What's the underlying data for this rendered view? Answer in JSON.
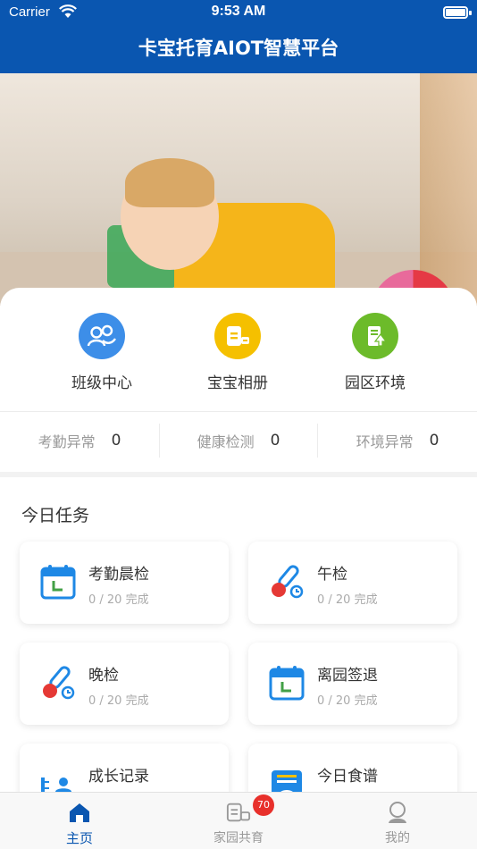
{
  "status_bar": {
    "carrier": "Carrier",
    "time": "9:53 AM"
  },
  "nav": {
    "title": "卡宝托育AIOT智慧平台"
  },
  "shortcuts": [
    {
      "label": "班级中心",
      "icon": "class-center-icon"
    },
    {
      "label": "宝宝相册",
      "icon": "baby-album-icon"
    },
    {
      "label": "园区环境",
      "icon": "campus-environment-icon"
    }
  ],
  "stats": [
    {
      "name": "考勤异常",
      "value": "0"
    },
    {
      "name": "健康检测",
      "value": "0"
    },
    {
      "name": "环境异常",
      "value": "0"
    }
  ],
  "tasks": {
    "heading": "今日任务",
    "items": [
      {
        "name": "考勤晨检",
        "progress": "0 / 20 完成",
        "icon": "calendar-icon"
      },
      {
        "name": "午检",
        "progress": "0 / 20 完成",
        "icon": "thermometer-icon"
      },
      {
        "name": "晚检",
        "progress": "0 / 20 完成",
        "icon": "thermometer-icon"
      },
      {
        "name": "离园签退",
        "progress": "0 / 20 完成",
        "icon": "calendar-icon"
      },
      {
        "name": "成长记录",
        "progress": "",
        "icon": "growth-record-icon"
      },
      {
        "name": "今日食谱",
        "progress": "",
        "icon": "recipe-icon"
      }
    ]
  },
  "tabbar": {
    "items": [
      {
        "label": "主页",
        "icon": "home-icon",
        "active": true
      },
      {
        "label": "家园共育",
        "icon": "co-education-icon",
        "badge": "70"
      },
      {
        "label": "我的",
        "icon": "profile-icon"
      }
    ]
  },
  "colors": {
    "primary": "#0a56b0",
    "badge": "#e8302b"
  }
}
